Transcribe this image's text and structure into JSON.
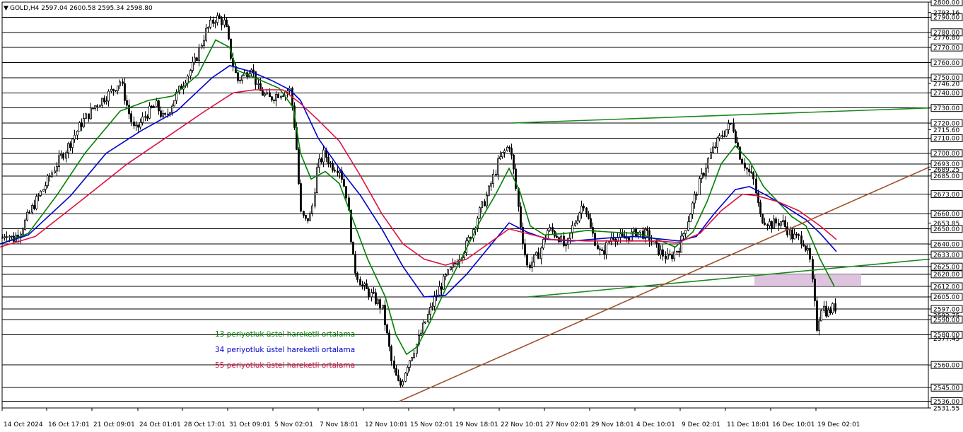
{
  "symbol_header": "GOLD,H4  2597.04 2600.58 2595.34 2598.80",
  "colors": {
    "background": "#ffffff",
    "grid": "#000000",
    "ema13": "#008000",
    "ema34": "#0000cc",
    "ema55": "#dd1144",
    "trend_green": "#1a8a1a",
    "trend_brown": "#a0522d",
    "zone": "#d8b8d8"
  },
  "chart_data": {
    "type": "candlestick",
    "title": "GOLD,H4",
    "timeframe": "H4",
    "ohlc_last": {
      "open": 2597.04,
      "high": 2600.58,
      "low": 2595.34,
      "close": 2598.8
    },
    "ylim": [
      2531.55,
      2800
    ],
    "grid": true,
    "grid_levels": [
      2800,
      2790,
      2780,
      2770,
      2760,
      2750,
      2740,
      2730,
      2720,
      2710,
      2700,
      2693,
      2685,
      2673,
      2660,
      2650,
      2640,
      2633,
      2625,
      2620,
      2612,
      2605,
      2597,
      2590,
      2580,
      2560,
      2545,
      2536
    ],
    "y_tick_labels": [
      "2800.00",
      "2790.00",
      "2780.00",
      "2770.00",
      "2760.00",
      "2750.00",
      "2740.00",
      "2730.00",
      "2720.00",
      "2715.60",
      "2710.00",
      "2700.00",
      "2693.00",
      "2685.00",
      "2673.00",
      "2660.00",
      "2650.00",
      "2640.00",
      "2633.00",
      "2625.00",
      "2620.00",
      "2612.00",
      "2605.00",
      "2597.00",
      "2590.00",
      "2580.00",
      "2577.45",
      "2560.00",
      "2545.00",
      "2536.00",
      "2531.55",
      "2793.16",
      "2776.80",
      "2746.20",
      "2689.25",
      "2653.85",
      "2592.75"
    ],
    "x_tick_labels": [
      "14 Oct 2024",
      "16 Oct 17:01",
      "21 Oct 09:01",
      "24 Oct 01:01",
      "28 Oct 17:01",
      "31 Oct 09:01",
      "5 Nov 02:01",
      "7 Nov 18:01",
      "12 Nov 10:01",
      "15 Nov 02:01",
      "19 Nov 18:01",
      "22 Nov 10:01",
      "27 Nov 02:01",
      "29 Nov 18:01",
      "4 Dec 10:01",
      "9 Dec 02:01",
      "11 Dec 18:01",
      "16 Dec 10:01",
      "19 Dec 02:01"
    ],
    "price_path": [
      [
        0,
        2642
      ],
      [
        8,
        2648
      ],
      [
        18,
        2643
      ],
      [
        30,
        2650
      ],
      [
        45,
        2664
      ],
      [
        60,
        2676
      ],
      [
        80,
        2693
      ],
      [
        100,
        2708
      ],
      [
        115,
        2720
      ],
      [
        135,
        2732
      ],
      [
        155,
        2740
      ],
      [
        170,
        2748
      ],
      [
        180,
        2730
      ],
      [
        190,
        2714
      ],
      [
        205,
        2725
      ],
      [
        220,
        2732
      ],
      [
        232,
        2722
      ],
      [
        245,
        2735
      ],
      [
        260,
        2748
      ],
      [
        275,
        2760
      ],
      [
        290,
        2780
      ],
      [
        305,
        2790
      ],
      [
        318,
        2786
      ],
      [
        326,
        2765
      ],
      [
        335,
        2748
      ],
      [
        345,
        2752
      ],
      [
        355,
        2758
      ],
      [
        365,
        2742
      ],
      [
        380,
        2736
      ],
      [
        395,
        2740
      ],
      [
        410,
        2742
      ],
      [
        418,
        2710
      ],
      [
        425,
        2660
      ],
      [
        432,
        2655
      ],
      [
        440,
        2660
      ],
      [
        448,
        2690
      ],
      [
        458,
        2700
      ],
      [
        468,
        2692
      ],
      [
        480,
        2690
      ],
      [
        490,
        2672
      ],
      [
        500,
        2625
      ],
      [
        512,
        2612
      ],
      [
        525,
        2606
      ],
      [
        540,
        2598
      ],
      [
        555,
        2558
      ],
      [
        565,
        2545
      ],
      [
        575,
        2560
      ],
      [
        590,
        2575
      ],
      [
        605,
        2593
      ],
      [
        620,
        2610
      ],
      [
        640,
        2625
      ],
      [
        660,
        2640
      ],
      [
        675,
        2658
      ],
      [
        690,
        2674
      ],
      [
        705,
        2695
      ],
      [
        720,
        2706
      ],
      [
        727,
        2686
      ],
      [
        735,
        2655
      ],
      [
        745,
        2625
      ],
      [
        760,
        2632
      ],
      [
        775,
        2650
      ],
      [
        790,
        2645
      ],
      [
        800,
        2636
      ],
      [
        810,
        2652
      ],
      [
        825,
        2668
      ],
      [
        835,
        2650
      ],
      [
        850,
        2632
      ],
      [
        865,
        2646
      ],
      [
        880,
        2643
      ],
      [
        900,
        2648
      ],
      [
        915,
        2646
      ],
      [
        930,
        2636
      ],
      [
        945,
        2630
      ],
      [
        960,
        2638
      ],
      [
        975,
        2660
      ],
      [
        990,
        2682
      ],
      [
        1005,
        2700
      ],
      [
        1020,
        2712
      ],
      [
        1035,
        2720
      ],
      [
        1045,
        2700
      ],
      [
        1055,
        2690
      ],
      [
        1065,
        2683
      ],
      [
        1075,
        2658
      ],
      [
        1090,
        2653
      ],
      [
        1105,
        2655
      ],
      [
        1120,
        2645
      ],
      [
        1135,
        2643
      ],
      [
        1145,
        2630
      ],
      [
        1155,
        2585
      ],
      [
        1162,
        2600
      ],
      [
        1170,
        2594
      ],
      [
        1178,
        2598
      ]
    ],
    "series": [
      {
        "name": "13 periyotluk üstel hareketli ortalama",
        "color": "#008000",
        "points": [
          [
            0,
            2640
          ],
          [
            40,
            2647
          ],
          [
            80,
            2672
          ],
          [
            120,
            2700
          ],
          [
            170,
            2728
          ],
          [
            210,
            2735
          ],
          [
            245,
            2738
          ],
          [
            280,
            2752
          ],
          [
            305,
            2775
          ],
          [
            325,
            2770
          ],
          [
            335,
            2755
          ],
          [
            365,
            2749
          ],
          [
            395,
            2743
          ],
          [
            415,
            2730
          ],
          [
            425,
            2700
          ],
          [
            440,
            2683
          ],
          [
            460,
            2688
          ],
          [
            480,
            2680
          ],
          [
            500,
            2655
          ],
          [
            520,
            2630
          ],
          [
            545,
            2605
          ],
          [
            560,
            2580
          ],
          [
            575,
            2567
          ],
          [
            590,
            2572
          ],
          [
            610,
            2590
          ],
          [
            630,
            2610
          ],
          [
            650,
            2628
          ],
          [
            680,
            2656
          ],
          [
            700,
            2672
          ],
          [
            720,
            2690
          ],
          [
            735,
            2675
          ],
          [
            750,
            2652
          ],
          [
            770,
            2646
          ],
          [
            800,
            2647
          ],
          [
            830,
            2649
          ],
          [
            860,
            2648
          ],
          [
            900,
            2647
          ],
          [
            930,
            2643
          ],
          [
            955,
            2638
          ],
          [
            980,
            2648
          ],
          [
            1000,
            2668
          ],
          [
            1020,
            2693
          ],
          [
            1040,
            2705
          ],
          [
            1060,
            2695
          ],
          [
            1080,
            2678
          ],
          [
            1100,
            2668
          ],
          [
            1120,
            2658
          ],
          [
            1140,
            2652
          ],
          [
            1160,
            2630
          ],
          [
            1180,
            2612
          ]
        ]
      },
      {
        "name": "34 periyotluk üstel hareketli ortalama",
        "color": "#0000cc",
        "points": [
          [
            0,
            2640
          ],
          [
            40,
            2646
          ],
          [
            100,
            2672
          ],
          [
            150,
            2700
          ],
          [
            200,
            2715
          ],
          [
            250,
            2728
          ],
          [
            300,
            2750
          ],
          [
            325,
            2758
          ],
          [
            355,
            2754
          ],
          [
            385,
            2748
          ],
          [
            410,
            2742
          ],
          [
            425,
            2735
          ],
          [
            450,
            2710
          ],
          [
            480,
            2690
          ],
          [
            510,
            2672
          ],
          [
            540,
            2650
          ],
          [
            570,
            2625
          ],
          [
            600,
            2605
          ],
          [
            630,
            2606
          ],
          [
            660,
            2620
          ],
          [
            690,
            2637
          ],
          [
            720,
            2654
          ],
          [
            745,
            2648
          ],
          [
            775,
            2643
          ],
          [
            810,
            2642
          ],
          [
            860,
            2644
          ],
          [
            900,
            2645
          ],
          [
            940,
            2643
          ],
          [
            960,
            2642
          ],
          [
            985,
            2645
          ],
          [
            1010,
            2660
          ],
          [
            1040,
            2676
          ],
          [
            1060,
            2678
          ],
          [
            1085,
            2672
          ],
          [
            1110,
            2665
          ],
          [
            1140,
            2656
          ],
          [
            1160,
            2647
          ],
          [
            1183,
            2635
          ]
        ]
      },
      {
        "name": "55 periyotluk üstel hareketli ortalama",
        "color": "#dd1144",
        "points": [
          [
            0,
            2638
          ],
          [
            50,
            2645
          ],
          [
            110,
            2667
          ],
          [
            180,
            2693
          ],
          [
            240,
            2712
          ],
          [
            290,
            2728
          ],
          [
            330,
            2740
          ],
          [
            360,
            2742
          ],
          [
            400,
            2742
          ],
          [
            425,
            2733
          ],
          [
            450,
            2722
          ],
          [
            480,
            2708
          ],
          [
            510,
            2685
          ],
          [
            540,
            2660
          ],
          [
            570,
            2640
          ],
          [
            600,
            2630
          ],
          [
            630,
            2626
          ],
          [
            660,
            2630
          ],
          [
            690,
            2640
          ],
          [
            720,
            2650
          ],
          [
            745,
            2647
          ],
          [
            780,
            2643
          ],
          [
            830,
            2642
          ],
          [
            880,
            2642
          ],
          [
            930,
            2642
          ],
          [
            960,
            2641
          ],
          [
            990,
            2647
          ],
          [
            1020,
            2662
          ],
          [
            1050,
            2673
          ],
          [
            1070,
            2672
          ],
          [
            1100,
            2668
          ],
          [
            1130,
            2662
          ],
          [
            1160,
            2652
          ],
          [
            1183,
            2643
          ]
        ]
      }
    ],
    "trendlines": [
      {
        "kind": "resistance",
        "color": "#1a8a1a",
        "from": [
          722,
          2720
        ],
        "to": [
          1315,
          2730
        ]
      },
      {
        "kind": "support",
        "color": "#1a8a1a",
        "from": [
          747,
          2605
        ],
        "to": [
          1315,
          2630
        ]
      },
      {
        "kind": "ascending",
        "color": "#a0522d",
        "from": [
          565,
          2536
        ],
        "to": [
          1315,
          2691
        ]
      }
    ],
    "zone": {
      "label": "",
      "color": "#d8b8d8",
      "from_x": 1067,
      "to_x": 1218,
      "y_low": 2612,
      "y_high": 2620
    },
    "legend": [
      {
        "label": "13 periyotluk üstel hareketli ortalama",
        "color": "#008000"
      },
      {
        "label": "34 periyotluk üstel hareketli ortalama",
        "color": "#0000cc"
      },
      {
        "label": "55 periyotluk üstel hareketli ortalama",
        "color": "#dd1144"
      }
    ],
    "legend_position": "lower-left"
  }
}
